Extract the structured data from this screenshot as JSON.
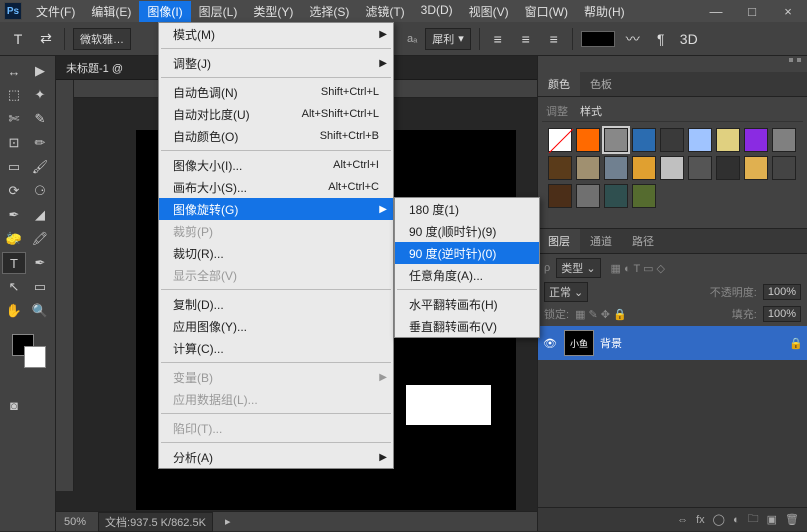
{
  "menubar": {
    "items": [
      "文件(F)",
      "编辑(E)",
      "图像(I)",
      "图层(L)",
      "类型(Y)",
      "选择(S)",
      "滤镜(T)",
      "3D(D)",
      "视图(V)",
      "窗口(W)",
      "帮助(H)"
    ],
    "open_index": 2
  },
  "optbar": {
    "font": "微软雅…",
    "aa": "犀利"
  },
  "doc": {
    "tab": "未标题-1 @"
  },
  "status": {
    "zoom": "50%",
    "docinfo": "文档:937.5 K/862.5K"
  },
  "panel_color": {
    "tabs": [
      "颜色",
      "色板"
    ],
    "active": 0,
    "subtabs": [
      "调整",
      "样式"
    ],
    "sub_active": 1
  },
  "panel_layers": {
    "tabs": [
      "图层",
      "通道",
      "路径"
    ],
    "active": 0,
    "kind": "类型",
    "blend": "正常",
    "opacity_lbl": "不透明度:",
    "opacity": "100%",
    "lock_lbl": "锁定:",
    "fill_lbl": "填充:",
    "fill": "100%",
    "layer_name_thumb": "小鱼",
    "layer_name": "背景"
  },
  "menu_image": {
    "items": [
      {
        "label": "模式(M)",
        "sub": true
      },
      {
        "sep": true
      },
      {
        "label": "调整(J)",
        "sub": true
      },
      {
        "sep": true
      },
      {
        "label": "自动色调(N)",
        "shortcut": "Shift+Ctrl+L"
      },
      {
        "label": "自动对比度(U)",
        "shortcut": "Alt+Shift+Ctrl+L"
      },
      {
        "label": "自动颜色(O)",
        "shortcut": "Shift+Ctrl+B"
      },
      {
        "sep": true
      },
      {
        "label": "图像大小(I)...",
        "shortcut": "Alt+Ctrl+I"
      },
      {
        "label": "画布大小(S)...",
        "shortcut": "Alt+Ctrl+C"
      },
      {
        "label": "图像旋转(G)",
        "sub": true,
        "hi": true
      },
      {
        "label": "裁剪(P)",
        "disabled": true
      },
      {
        "label": "裁切(R)..."
      },
      {
        "label": "显示全部(V)",
        "disabled": true
      },
      {
        "sep": true
      },
      {
        "label": "复制(D)..."
      },
      {
        "label": "应用图像(Y)..."
      },
      {
        "label": "计算(C)..."
      },
      {
        "sep": true
      },
      {
        "label": "变量(B)",
        "sub": true,
        "disabled": true
      },
      {
        "label": "应用数据组(L)...",
        "disabled": true
      },
      {
        "sep": true
      },
      {
        "label": "陷印(T)...",
        "disabled": true
      },
      {
        "sep": true
      },
      {
        "label": "分析(A)",
        "sub": true
      }
    ]
  },
  "menu_rotate": {
    "items": [
      {
        "label": "180 度(1)"
      },
      {
        "label": "90 度(顺时针)(9)"
      },
      {
        "label": "90 度(逆时针)(0)",
        "hi": true
      },
      {
        "label": "任意角度(A)..."
      },
      {
        "sep": true
      },
      {
        "label": "水平翻转画布(H)"
      },
      {
        "label": "垂直翻转画布(V)"
      }
    ]
  },
  "style_colors": [
    "none",
    "#ff6a00",
    "#888888",
    "#2b6cb0",
    "#3a3a3a",
    "#a0c4ff",
    "#e0d080",
    "#8a2be2",
    "#808080",
    "#5a3b1a",
    "#a09070",
    "#708090",
    "#e0a030",
    "#c0c0c0",
    "#555555",
    "#303030",
    "#e0b050",
    "#444444",
    "#4b2e18",
    "#707070",
    "#2f4f4f",
    "#556b2f"
  ]
}
